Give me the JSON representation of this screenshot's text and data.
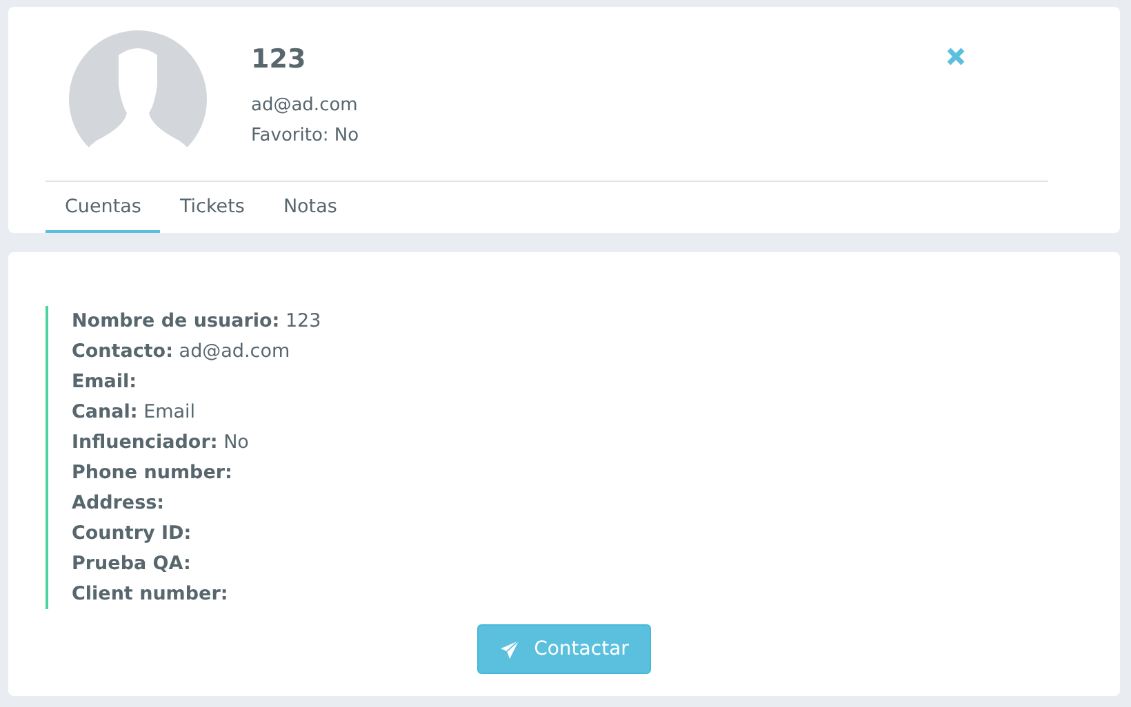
{
  "profile": {
    "name": "123",
    "email": "ad@ad.com",
    "favorite": "Favorito: No"
  },
  "tabs": [
    {
      "label": "Cuentas",
      "selected": true
    },
    {
      "label": "Tickets",
      "selected": false
    },
    {
      "label": "Notas",
      "selected": false
    }
  ],
  "fields": [
    {
      "label": "Nombre de usuario:",
      "value": "123"
    },
    {
      "label": "Contacto:",
      "value": "ad@ad.com"
    },
    {
      "label": "Email:"
    },
    {
      "label": "Canal:",
      "value": "Email"
    },
    {
      "label": "Influenciador:",
      "value": "No"
    },
    {
      "label": "Phone number:"
    },
    {
      "label": "Address:"
    },
    {
      "label": "Country ID:"
    },
    {
      "label": "Prueba QA:"
    },
    {
      "label": "Client number:"
    }
  ],
  "contact_button": {
    "label": "Contactar"
  }
}
